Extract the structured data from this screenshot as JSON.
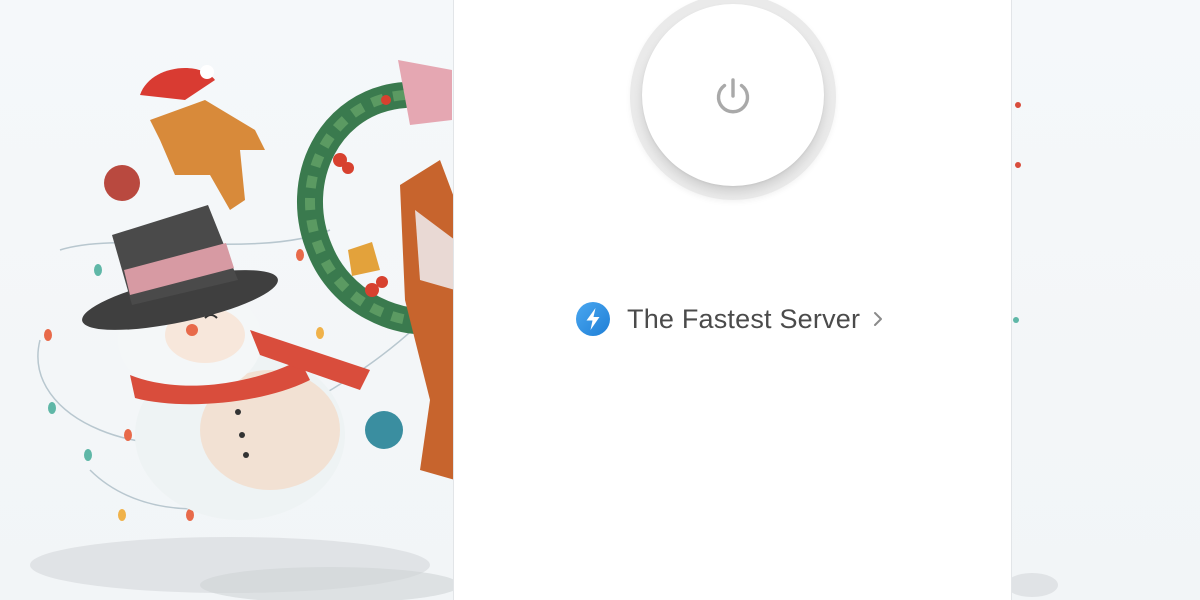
{
  "server_selector": {
    "label": "The Fastest Server"
  },
  "power_button": {
    "state": "off"
  },
  "icons": {
    "power": "power-icon",
    "server": "lightning-bolt-icon",
    "chevron": "chevron-right-icon"
  },
  "colors": {
    "accent_blue": "#2f8fe4",
    "power_gray": "#a9a9a9",
    "text": "#4b4b4b",
    "panel_bg": "#ffffff",
    "page_bg": "#f4f7f9"
  }
}
